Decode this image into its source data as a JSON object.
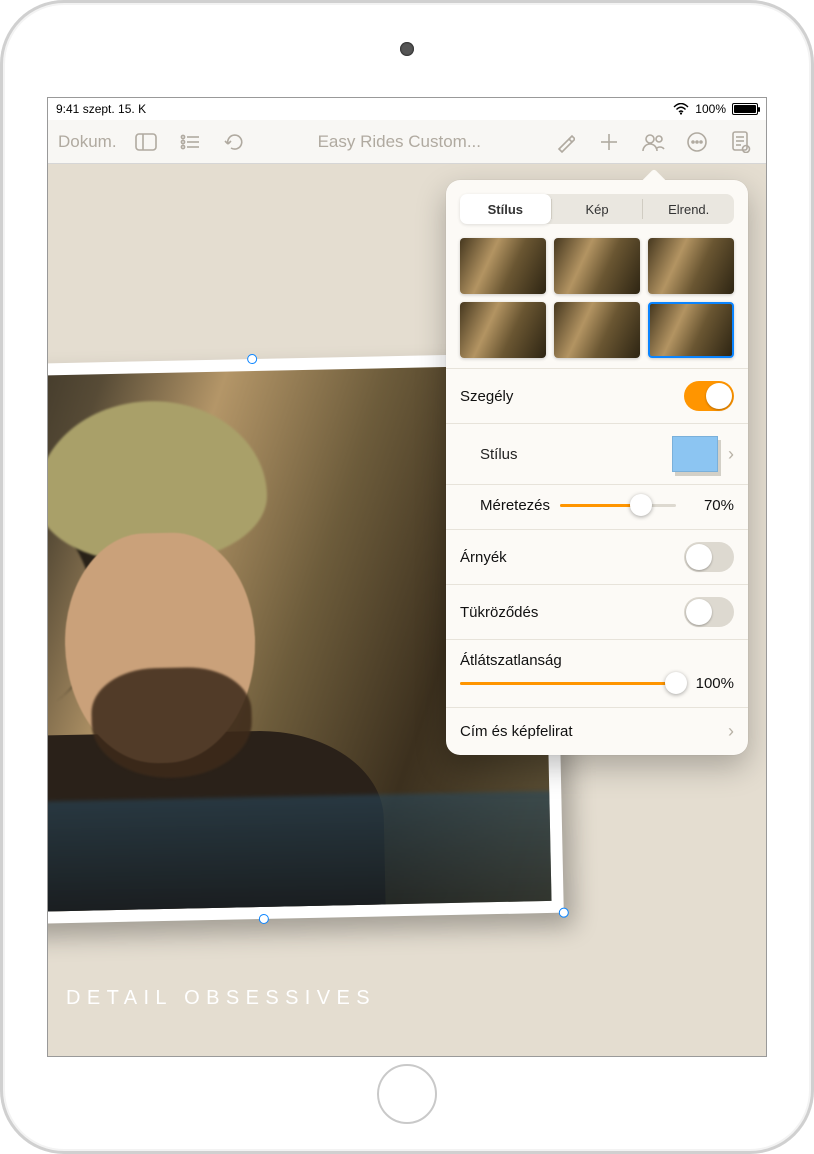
{
  "status": {
    "time": "9:41",
    "date": "szept. 15. K",
    "battery": "100%"
  },
  "toolbar": {
    "back": "Dokum.",
    "title": "Easy Rides Custom..."
  },
  "caption": "DETAIL OBSESSIVES",
  "popover": {
    "tabs": {
      "style": "Stílus",
      "image": "Kép",
      "arrange": "Elrend."
    },
    "border": {
      "label": "Szegély",
      "on": true
    },
    "border_style": {
      "label": "Stílus"
    },
    "scale": {
      "label": "Méretezés",
      "value": 70,
      "text": "70%"
    },
    "shadow": {
      "label": "Árnyék",
      "on": false
    },
    "reflection": {
      "label": "Tükröződés",
      "on": false
    },
    "opacity": {
      "label": "Átlátszatlanság",
      "value": 100,
      "text": "100%"
    },
    "caption_row": {
      "label": "Cím és képfelirat"
    }
  }
}
